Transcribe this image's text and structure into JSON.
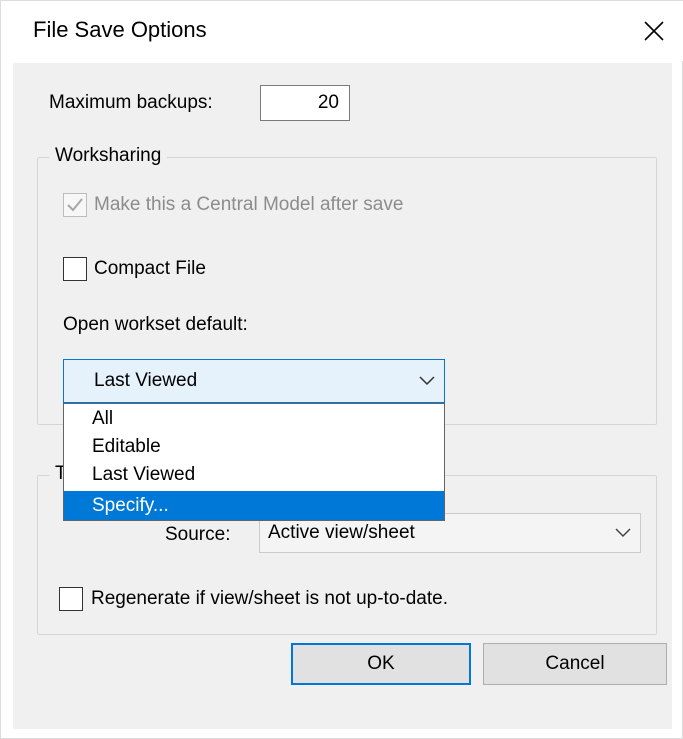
{
  "dialog": {
    "title": "File Save Options",
    "close_icon": "close-icon"
  },
  "backups": {
    "label": "Maximum backups:",
    "value": "20"
  },
  "worksharing": {
    "group_title": "Worksharing",
    "central_model_label": "Make this a Central Model after save",
    "central_model_checked": true,
    "central_model_enabled": false,
    "compact_file_label": "Compact File",
    "compact_file_checked": false,
    "open_workset_label": "Open workset default:",
    "open_workset_value": "Last Viewed",
    "open_workset_options": [
      "All",
      "Editable",
      "Last Viewed",
      "Specify..."
    ],
    "highlighted_option": "Specify..."
  },
  "thumbnail": {
    "group_title_visible": "T",
    "source_label": "Source:",
    "source_value": "Active view/sheet",
    "regenerate_label": "Regenerate if view/sheet is not up-to-date.",
    "regenerate_checked": false
  },
  "buttons": {
    "ok_label": "OK",
    "cancel_label": "Cancel"
  },
  "colors": {
    "accent": "#0078d7",
    "dialog_bg": "#f0f0f0",
    "combo_focus_bg": "#e5f1fb",
    "disabled_text": "#8c8c8c"
  }
}
